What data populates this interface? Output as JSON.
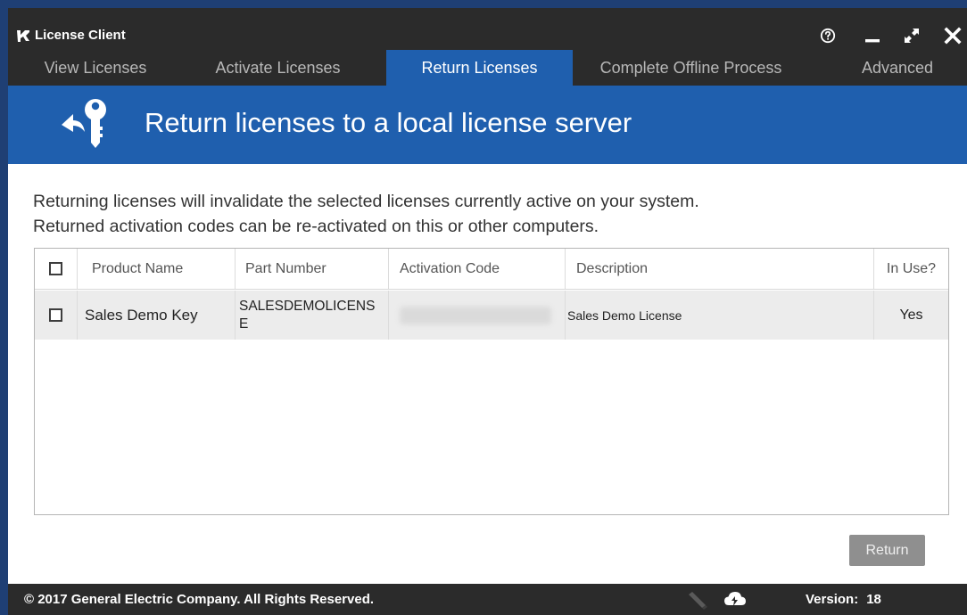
{
  "window": {
    "title": "License Client",
    "controls": [
      "help-icon",
      "minimize-icon",
      "maximize-icon",
      "close-icon"
    ]
  },
  "tabs": [
    {
      "label": "View Licenses",
      "active": false
    },
    {
      "label": "Activate Licenses",
      "active": false
    },
    {
      "label": "Return Licenses",
      "active": true
    },
    {
      "label": "Complete Offline Process",
      "active": false
    },
    {
      "label": "Advanced",
      "active": false
    }
  ],
  "banner": {
    "title": "Return licenses to a local license server",
    "icon": "return-key-icon"
  },
  "intro": {
    "line1": "Returning licenses will invalidate the selected licenses currently active on your system.",
    "line2": "Returned activation codes can be re-activated on this or other computers."
  },
  "table": {
    "columns": [
      "Product Name",
      "Part Number",
      "Activation Code",
      "Description",
      "In Use?"
    ],
    "rows": [
      {
        "product_name": "Sales Demo Key",
        "part_number": "SALESDEMOLICENSE",
        "activation_code": "",
        "description": "Sales Demo License",
        "in_use": "Yes"
      }
    ]
  },
  "actions": {
    "return_label": "Return"
  },
  "footer": {
    "copyright": "© 2017 General Electric Company.  All Rights Reserved.",
    "version_label": "Version:",
    "version_value": "18"
  },
  "colors": {
    "titlebar": "#2b2b2b",
    "accent_blue": "#1f5fae",
    "row_bg": "#ececec",
    "button_disabled": "#8f8f8f"
  }
}
